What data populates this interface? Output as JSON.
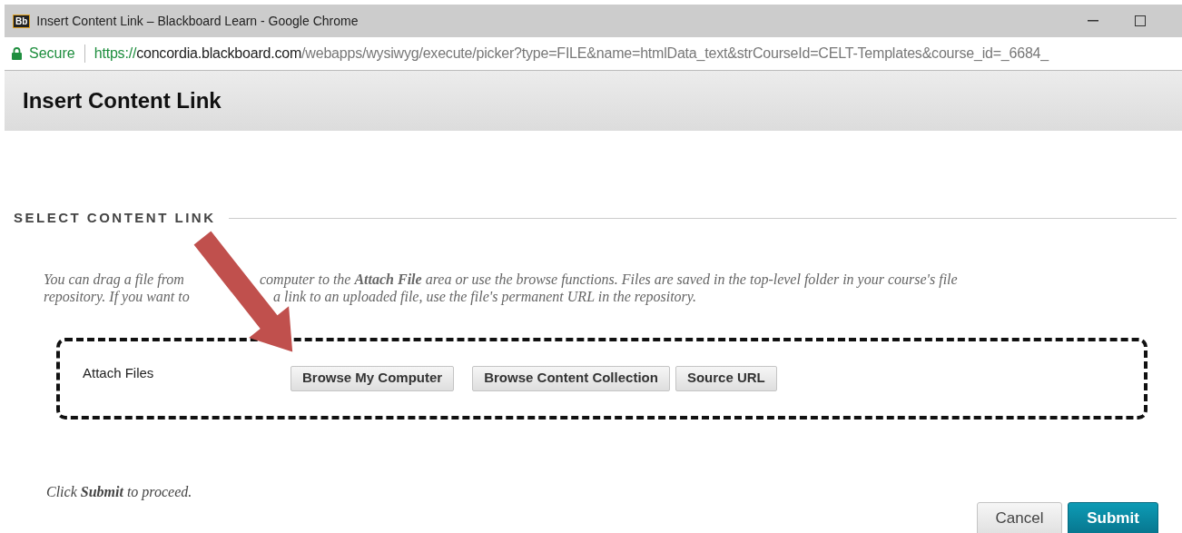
{
  "window": {
    "title": "Insert Content Link – Blackboard Learn - Google Chrome",
    "app_badge": "Bb"
  },
  "address_bar": {
    "secure_label": "Secure",
    "url_scheme": "https://",
    "url_host": "concordia.blackboard.com",
    "url_path": "/webapps/wysiwyg/execute/picker?type=FILE&name=htmlData_text&strCourseId=CELT-Templates&course_id=_6684_"
  },
  "page_header": {
    "title": "Insert Content Link"
  },
  "section": {
    "heading": "SELECT CONTENT LINK",
    "instruction_lines": [
      [
        "You can drag a file from",
        "computer to the **Attach File** area or use the browse functions. Files are saved in the top-level folder in your course's file"
      ],
      [
        "repository. If you want to",
        "a link to an uploaded file, use the file's permanent URL in the repository."
      ]
    ]
  },
  "attach": {
    "label": "Attach Files",
    "buttons": [
      "Browse My Computer",
      "Browse Content Collection",
      "Source URL"
    ]
  },
  "footer_note": "Click **Submit** to proceed.",
  "actions": [
    {
      "label": "Cancel",
      "kind": "secondary"
    },
    {
      "label": "Submit",
      "kind": "primary"
    }
  ]
}
